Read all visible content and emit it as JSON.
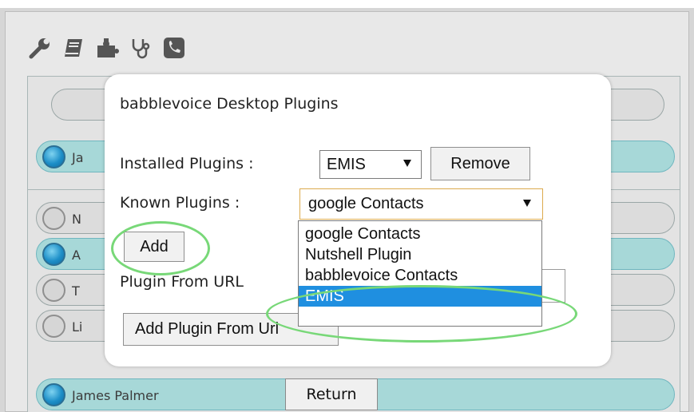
{
  "toolbar": {
    "icons": [
      "wrench-icon",
      "book-icon",
      "puzzle-icon",
      "stethoscope-icon",
      "phone-icon"
    ],
    "icon_color": "#555555"
  },
  "contacts": [
    {
      "name": "Ja",
      "status": "online"
    },
    {
      "name": "N",
      "status": "offline"
    },
    {
      "name": "A",
      "status": "online"
    },
    {
      "name": "T",
      "status": "offline"
    },
    {
      "name": "Li",
      "status": "offline"
    },
    {
      "name": "James Palmer",
      "status": "online"
    }
  ],
  "return_label": "Return",
  "modal": {
    "title": "babblevoice Desktop Plugins",
    "installed_label": "Installed Plugins :",
    "installed_value": "EMIS",
    "remove_label": "Remove",
    "known_label": "Known Plugins :",
    "known_value": "google Contacts",
    "known_options": [
      "google Contacts",
      "Nutshell Plugin",
      "babblevoice Contacts",
      "EMIS"
    ],
    "add_label": "Add",
    "url_label": "Plugin From URL",
    "add_url_label": "Add Plugin From Url"
  },
  "colors": {
    "highlight_circle": "#78d878",
    "selected_option": "#1f8fe0",
    "online_row": "#a7d8d8"
  }
}
